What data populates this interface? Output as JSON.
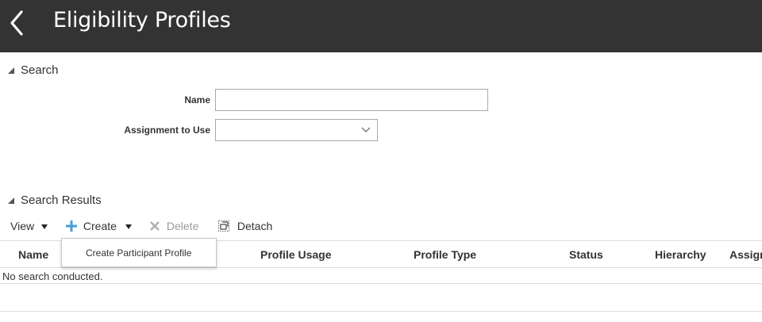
{
  "header": {
    "title": "Eligibility Profiles"
  },
  "search_section": {
    "title": "Search",
    "fields": {
      "name_label": "Name",
      "name_value": "",
      "assignment_label": "Assignment to Use",
      "assignment_value": ""
    }
  },
  "results_section": {
    "title": "Search Results",
    "toolbar": {
      "view_label": "View",
      "create_label": "Create",
      "delete_label": "Delete",
      "detach_label": "Detach"
    },
    "create_menu": {
      "items": [
        "Create Participant Profile"
      ]
    },
    "columns": [
      "Name",
      "Profile Usage",
      "Profile Type",
      "Status",
      "Hierarchy",
      "Assign"
    ],
    "empty_message": "No search conducted."
  },
  "colors": {
    "header_bg": "#333333",
    "header_text": "#ffffff",
    "create_icon": "#4a9ad6",
    "disabled_text": "#9a9a9a"
  },
  "icons": [
    "back-chevron-icon",
    "collapse-triangle-icon",
    "chevron-down-icon",
    "dropdown-arrow-icon",
    "plus-icon",
    "delete-x-icon",
    "detach-icon"
  ]
}
